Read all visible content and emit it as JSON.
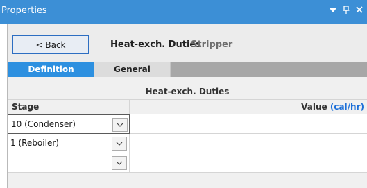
{
  "window": {
    "title": "Properties",
    "controls": [
      "▾",
      "ᵖ",
      "✕"
    ]
  },
  "header": {
    "back_label": "< Back",
    "title": "Heat-exch. Duties",
    "subtitle": "Stripper"
  },
  "tabs": [
    {
      "label": "Definition",
      "active": true
    },
    {
      "label": "General",
      "active": false
    }
  ],
  "grid": {
    "section_title": "Heat-exch. Duties",
    "col_stage": "Stage",
    "col_value": "Value",
    "col_value_unit": "(cal/hr)",
    "rows": [
      {
        "stage": "10 (Condenser)",
        "value": ""
      },
      {
        "stage": "1 (Reboiler)",
        "value": ""
      },
      {
        "stage": "",
        "value": ""
      }
    ]
  },
  "colors": {
    "titlebar": "#3c8fd6",
    "active_tab": "#2d90e0",
    "unit_link": "#1a6ed8"
  },
  "icons": {
    "dropdown": "chevron-down-icon"
  }
}
